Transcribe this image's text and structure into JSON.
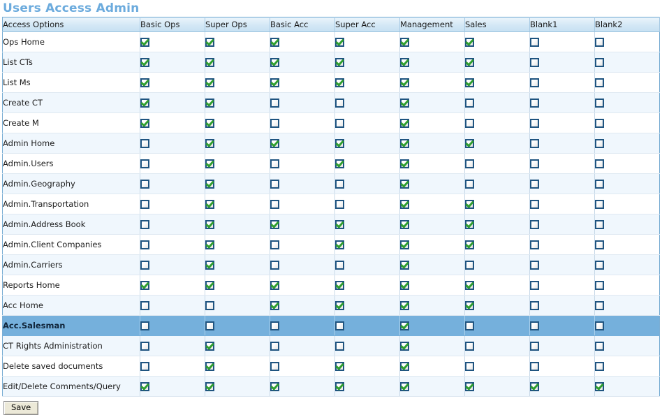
{
  "page": {
    "title": "Users Access Admin",
    "title_color": "#6cabdd",
    "selected_row_color": "#75b0dc",
    "check_color": "#2f9e2f",
    "checkbox_border_color": "#1f5480"
  },
  "table": {
    "columns": [
      "Access Options",
      "Basic Ops",
      "Super Ops",
      "Basic Acc",
      "Super Acc",
      "Management",
      "Sales",
      "Blank1",
      "Blank2"
    ],
    "rows": [
      {
        "label": "Ops Home",
        "selected": false,
        "values": [
          true,
          true,
          true,
          true,
          true,
          true,
          false,
          false
        ]
      },
      {
        "label": "List CTs",
        "selected": false,
        "values": [
          true,
          true,
          true,
          true,
          true,
          true,
          false,
          false
        ]
      },
      {
        "label": "List Ms",
        "selected": false,
        "values": [
          true,
          true,
          true,
          true,
          true,
          true,
          false,
          false
        ]
      },
      {
        "label": "Create CT",
        "selected": false,
        "values": [
          true,
          true,
          false,
          false,
          true,
          false,
          false,
          false
        ]
      },
      {
        "label": "Create M",
        "selected": false,
        "values": [
          true,
          true,
          false,
          false,
          true,
          false,
          false,
          false
        ]
      },
      {
        "label": "Admin Home",
        "selected": false,
        "values": [
          false,
          true,
          true,
          true,
          true,
          true,
          false,
          false
        ]
      },
      {
        "label": "Admin.Users",
        "selected": false,
        "values": [
          false,
          true,
          false,
          true,
          true,
          false,
          false,
          false
        ]
      },
      {
        "label": "Admin.Geography",
        "selected": false,
        "values": [
          false,
          true,
          false,
          false,
          true,
          false,
          false,
          false
        ]
      },
      {
        "label": "Admin.Transportation",
        "selected": false,
        "values": [
          false,
          true,
          false,
          false,
          true,
          true,
          false,
          false
        ]
      },
      {
        "label": "Admin.Address Book",
        "selected": false,
        "values": [
          false,
          true,
          true,
          true,
          true,
          true,
          false,
          false
        ]
      },
      {
        "label": "Admin.Client Companies",
        "selected": false,
        "values": [
          false,
          true,
          false,
          true,
          true,
          true,
          false,
          false
        ]
      },
      {
        "label": "Admin.Carriers",
        "selected": false,
        "values": [
          false,
          true,
          false,
          false,
          true,
          false,
          false,
          false
        ]
      },
      {
        "label": "Reports Home",
        "selected": false,
        "values": [
          true,
          true,
          true,
          true,
          true,
          true,
          false,
          false
        ]
      },
      {
        "label": "Acc Home",
        "selected": false,
        "values": [
          false,
          false,
          true,
          true,
          true,
          true,
          false,
          false
        ]
      },
      {
        "label": "Acc.Salesman",
        "selected": true,
        "values": [
          false,
          false,
          false,
          false,
          true,
          false,
          false,
          false
        ]
      },
      {
        "label": "CT Rights Administration",
        "selected": false,
        "values": [
          false,
          true,
          false,
          false,
          true,
          false,
          false,
          false
        ]
      },
      {
        "label": "Delete saved documents",
        "selected": false,
        "values": [
          false,
          true,
          false,
          true,
          true,
          false,
          false,
          false
        ]
      },
      {
        "label": "Edit/Delete Comments/Query",
        "selected": false,
        "values": [
          true,
          true,
          true,
          true,
          true,
          true,
          true,
          true
        ]
      }
    ]
  },
  "footer": {
    "save_label": "Save"
  }
}
